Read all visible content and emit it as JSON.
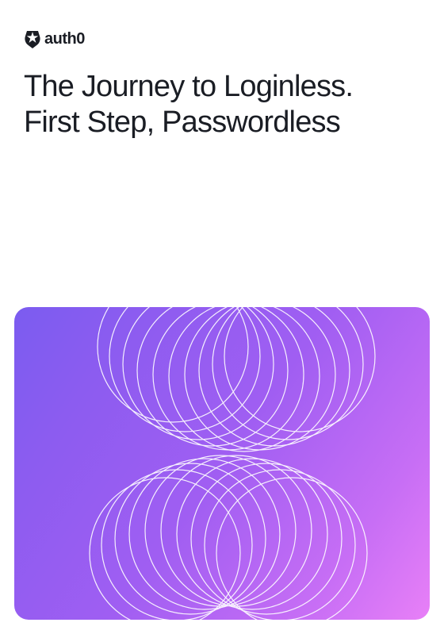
{
  "brand": {
    "name": "auth0"
  },
  "document": {
    "title_line1": "The Journey to Loginless.",
    "title_line2": "First Step, Passwordless"
  },
  "colors": {
    "text": "#1a1d24",
    "gradient_start": "#7b5cf0",
    "gradient_end": "#e880f7"
  }
}
